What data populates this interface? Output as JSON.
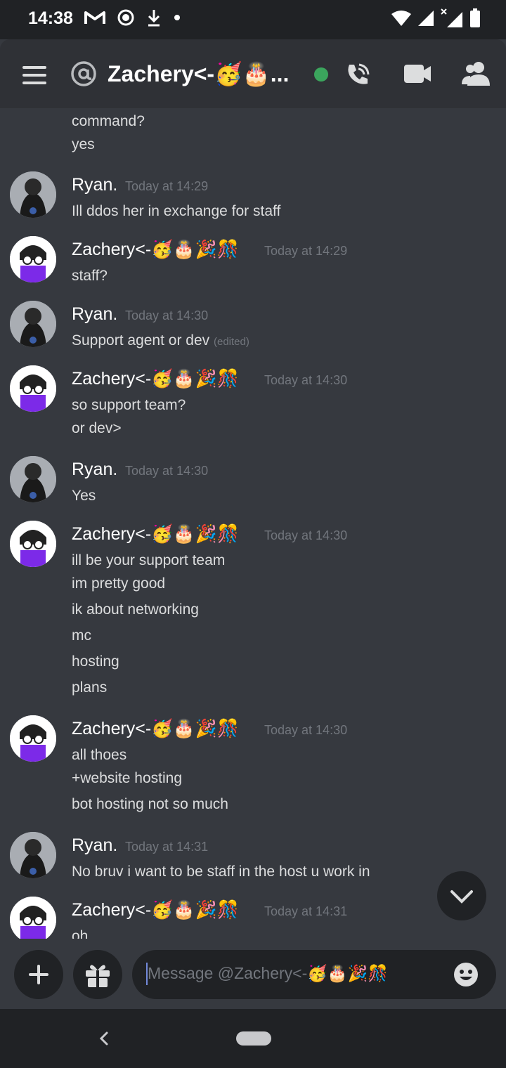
{
  "status_bar": {
    "time": "14:38"
  },
  "header": {
    "title": "Zachery<-🥳🎂...",
    "online_color": "#3ba55d"
  },
  "messages": [
    {
      "lines": [
        "command?",
        "yes"
      ]
    },
    {
      "author": "Ryan.",
      "timestamp": "Today at 14:29",
      "lines": [
        "Ill ddos her in exchange for staff"
      ]
    },
    {
      "author": "Zachery<-🥳🎂🎉🎊",
      "timestamp": "Today at 14:29",
      "lines": [
        "staff?"
      ]
    },
    {
      "author": "Ryan.",
      "timestamp": "Today at 14:30",
      "lines": [
        "Support agent or dev"
      ],
      "edited": "(edited)"
    },
    {
      "author": "Zachery<-🥳🎂🎉🎊",
      "timestamp": "Today at 14:30",
      "lines": [
        "so support team?",
        "or dev>"
      ]
    },
    {
      "author": "Ryan.",
      "timestamp": "Today at 14:30",
      "lines": [
        "Yes"
      ]
    },
    {
      "author": "Zachery<-🥳🎂🎉🎊",
      "timestamp": "Today at 14:30",
      "lines": [
        "ill be your support team",
        "im pretty good",
        "ik about networking",
        "mc",
        "hosting",
        "plans"
      ]
    },
    {
      "author": "Zachery<-🥳🎂🎉🎊",
      "timestamp": "Today at 14:30",
      "lines": [
        "all thoes",
        "+website hosting",
        "bot hosting not so much"
      ]
    },
    {
      "author": "Ryan.",
      "timestamp": "Today at 14:31",
      "lines": [
        "No bruv i want to be staff in the host u work in"
      ]
    },
    {
      "author": "Zachery<-🥳🎂🎉🎊",
      "timestamp": "Today at 14:31",
      "lines": [
        "oh"
      ]
    }
  ],
  "input": {
    "placeholder": "Message @Zachery<-🥳🎂🎉🎊"
  },
  "icons": {
    "menu": "hamburger-icon",
    "mention": "at-icon",
    "call": "phone-call-icon",
    "video": "video-camera-icon",
    "members": "members-icon",
    "add": "plus-icon",
    "gift": "gift-icon",
    "emoji": "emoji-icon",
    "scroll": "chevron-down-icon",
    "back": "back-chevron-icon"
  }
}
